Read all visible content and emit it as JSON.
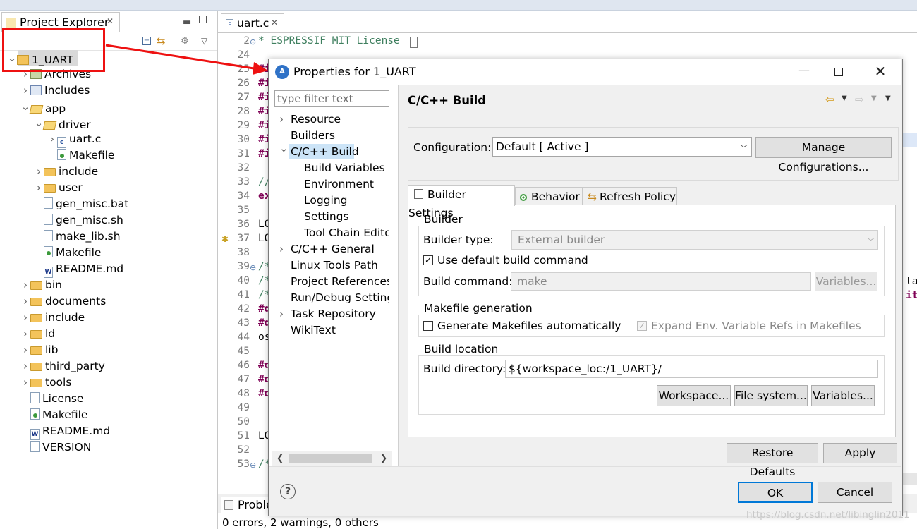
{
  "explorer": {
    "tab_label": "Project Explorer",
    "tree": [
      {
        "label": "1_UART",
        "depth": 0,
        "twisty": "open",
        "icon": "project-icon"
      },
      {
        "label": "Archives",
        "depth": 1,
        "twisty": "closed",
        "icon": "archive-icon"
      },
      {
        "label": "Includes",
        "depth": 1,
        "twisty": "closed",
        "icon": "includes-icon"
      },
      {
        "label": "app",
        "depth": 1,
        "twisty": "open",
        "icon": "folder-open-icon"
      },
      {
        "label": "driver",
        "depth": 2,
        "twisty": "open",
        "icon": "folder-open-icon"
      },
      {
        "label": "uart.c",
        "depth": 3,
        "twisty": "closed",
        "icon": "c-file-icon"
      },
      {
        "label": "Makefile",
        "depth": 3,
        "twisty": "",
        "icon": "makefile-icon"
      },
      {
        "label": "include",
        "depth": 2,
        "twisty": "closed",
        "icon": "folder-icon"
      },
      {
        "label": "user",
        "depth": 2,
        "twisty": "closed",
        "icon": "folder-icon"
      },
      {
        "label": "gen_misc.bat",
        "depth": 2,
        "twisty": "",
        "icon": "file-icon"
      },
      {
        "label": "gen_misc.sh",
        "depth": 2,
        "twisty": "",
        "icon": "file-icon"
      },
      {
        "label": "make_lib.sh",
        "depth": 2,
        "twisty": "",
        "icon": "file-icon"
      },
      {
        "label": "Makefile",
        "depth": 2,
        "twisty": "",
        "icon": "makefile-icon"
      },
      {
        "label": "README.md",
        "depth": 2,
        "twisty": "",
        "icon": "markdown-file-icon"
      },
      {
        "label": "bin",
        "depth": 1,
        "twisty": "closed",
        "icon": "folder-icon"
      },
      {
        "label": "documents",
        "depth": 1,
        "twisty": "closed",
        "icon": "folder-icon"
      },
      {
        "label": "include",
        "depth": 1,
        "twisty": "closed",
        "icon": "folder-icon"
      },
      {
        "label": "ld",
        "depth": 1,
        "twisty": "closed",
        "icon": "folder-icon"
      },
      {
        "label": "lib",
        "depth": 1,
        "twisty": "closed",
        "icon": "folder-icon"
      },
      {
        "label": "third_party",
        "depth": 1,
        "twisty": "closed",
        "icon": "folder-icon"
      },
      {
        "label": "tools",
        "depth": 1,
        "twisty": "closed",
        "icon": "folder-icon"
      },
      {
        "label": "License",
        "depth": 1,
        "twisty": "",
        "icon": "file-icon"
      },
      {
        "label": "Makefile",
        "depth": 1,
        "twisty": "",
        "icon": "makefile-icon"
      },
      {
        "label": "README.md",
        "depth": 1,
        "twisty": "",
        "icon": "markdown-file-icon"
      },
      {
        "label": "VERSION",
        "depth": 1,
        "twisty": "",
        "icon": "file-icon"
      }
    ]
  },
  "editor": {
    "tab_label": "uart.c",
    "lines": [
      {
        "n": "2",
        "code": " * ESPRESSIF MIT License",
        "kind": "cm"
      },
      {
        "n": "24",
        "code": "",
        "kind": ""
      },
      {
        "n": "25",
        "code": "#i",
        "kind": "kw"
      },
      {
        "n": "26",
        "code": "#i",
        "kind": "kw"
      },
      {
        "n": "27",
        "code": "#i",
        "kind": "kw"
      },
      {
        "n": "28",
        "code": "#i",
        "kind": "kw"
      },
      {
        "n": "29",
        "code": "#i",
        "kind": "kw"
      },
      {
        "n": "30",
        "code": "#i",
        "kind": "kw"
      },
      {
        "n": "31",
        "code": "#i",
        "kind": "kw"
      },
      {
        "n": "32",
        "code": "",
        "kind": ""
      },
      {
        "n": "33",
        "code": "//",
        "kind": "cm"
      },
      {
        "n": "34",
        "code": "ex",
        "kind": "kw"
      },
      {
        "n": "35",
        "code": "",
        "kind": ""
      },
      {
        "n": "36",
        "code": "LO",
        "kind": ""
      },
      {
        "n": "37",
        "code": "LO",
        "kind": ""
      },
      {
        "n": "38",
        "code": "",
        "kind": ""
      },
      {
        "n": "39",
        "code": "/*",
        "kind": "cm"
      },
      {
        "n": "40",
        "code": "/*",
        "kind": "cm"
      },
      {
        "n": "41",
        "code": "/*",
        "kind": "cm"
      },
      {
        "n": "42",
        "code": "#d",
        "kind": "kw"
      },
      {
        "n": "43",
        "code": "#d",
        "kind": "kw"
      },
      {
        "n": "44",
        "code": "os",
        "kind": ""
      },
      {
        "n": "45",
        "code": "",
        "kind": ""
      },
      {
        "n": "46",
        "code": "#d",
        "kind": "kw"
      },
      {
        "n": "47",
        "code": "#d",
        "kind": "kw"
      },
      {
        "n": "48",
        "code": "#d",
        "kind": "kw"
      },
      {
        "n": "49",
        "code": "",
        "kind": ""
      },
      {
        "n": "50",
        "code": "",
        "kind": ""
      },
      {
        "n": "51",
        "code": "LO",
        "kind": ""
      },
      {
        "n": "52",
        "code": "",
        "kind": ""
      },
      {
        "n": "53",
        "code": "/*",
        "kind": "cm"
      }
    ],
    "right_edge_1": "ta",
    "right_edge_2": "it"
  },
  "problems": {
    "tab_label": "Proble",
    "status": "0 errors, 2 warnings, 0 others"
  },
  "dialog": {
    "title": "Properties for 1_UART",
    "filter_placeholder": "type filter text",
    "nav": [
      {
        "label": "Resource",
        "depth": 0,
        "twisty": "closed"
      },
      {
        "label": "Builders",
        "depth": 0,
        "twisty": ""
      },
      {
        "label": "C/C++ Build",
        "depth": 0,
        "twisty": "open"
      },
      {
        "label": "Build Variables",
        "depth": 1,
        "twisty": ""
      },
      {
        "label": "Environment",
        "depth": 1,
        "twisty": ""
      },
      {
        "label": "Logging",
        "depth": 1,
        "twisty": ""
      },
      {
        "label": "Settings",
        "depth": 1,
        "twisty": ""
      },
      {
        "label": "Tool Chain Editor",
        "depth": 1,
        "twisty": ""
      },
      {
        "label": "C/C++ General",
        "depth": 0,
        "twisty": "closed"
      },
      {
        "label": "Linux Tools Path",
        "depth": 0,
        "twisty": ""
      },
      {
        "label": "Project References",
        "depth": 0,
        "twisty": ""
      },
      {
        "label": "Run/Debug Settings",
        "depth": 0,
        "twisty": ""
      },
      {
        "label": "Task Repository",
        "depth": 0,
        "twisty": "closed"
      },
      {
        "label": "WikiText",
        "depth": 0,
        "twisty": ""
      }
    ],
    "page_title": "C/C++ Build",
    "configuration_label": "Configuration:",
    "configuration_value": "Default  [ Active ]",
    "manage_button": "Manage Configurations...",
    "tabs": [
      "Builder Settings",
      "Behavior",
      "Refresh Policy"
    ],
    "builder": {
      "group_title": "Builder",
      "type_label": "Builder type:",
      "type_value": "External builder",
      "use_default_label": "Use default build command",
      "command_label": "Build command:",
      "command_value": "make",
      "variables_button": "Variables..."
    },
    "makefile": {
      "group_title": "Makefile generation",
      "generate_label": "Generate Makefiles automatically",
      "expand_label": "Expand Env. Variable Refs in Makefiles"
    },
    "location": {
      "group_title": "Build location",
      "directory_label": "Build directory:",
      "directory_value": "${workspace_loc:/1_UART}/",
      "workspace_button": "Workspace...",
      "filesystem_button": "File system...",
      "variables_button": "Variables..."
    },
    "restore_button": "Restore Defaults",
    "apply_button": "Apply",
    "ok_button": "OK",
    "cancel_button": "Cancel"
  },
  "watermark": "https://blog.csdn.net/libinglin2011",
  "colors": {
    "highlight_box": "#ee1111",
    "arrow": "#ee1111",
    "selection": "#cce4f7",
    "ok_border": "#0078d7"
  }
}
